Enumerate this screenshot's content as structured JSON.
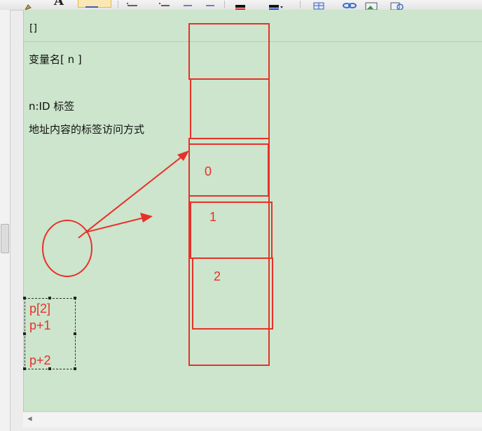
{
  "toolbar": {
    "font_button_glyph": "A"
  },
  "notes": {
    "bracket": "[]",
    "line1": "变量名[ n ]",
    "line2": "n:ID  标签",
    "line3": "地址内容的标签访问方式"
  },
  "memory": {
    "cells": [
      "",
      "",
      "0",
      "1",
      "2",
      ""
    ]
  },
  "selection": {
    "lines": [
      "p[2]",
      "p+1",
      "p+2"
    ]
  },
  "scroll": {
    "left_arrow": "◂"
  },
  "colors": {
    "canvas": "#cce5cc",
    "ink": "#e8302a"
  }
}
